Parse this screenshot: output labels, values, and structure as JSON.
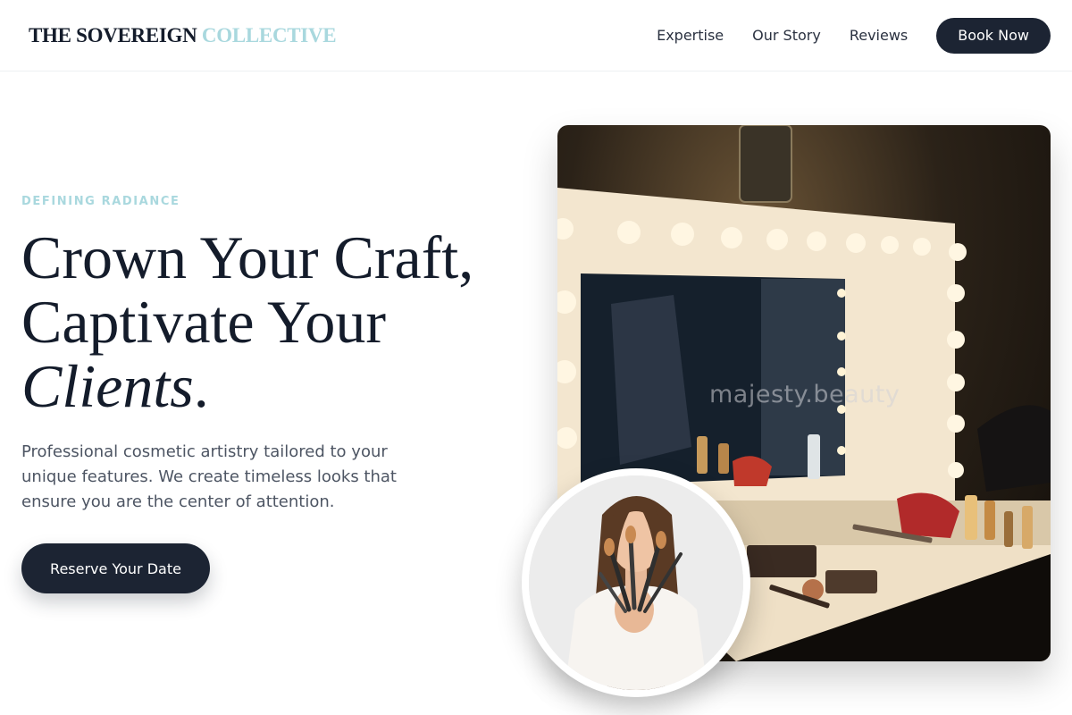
{
  "header": {
    "logo_main": "THE SOVEREIGN",
    "logo_accent": "COLLECTIVE",
    "nav": [
      {
        "label": "Expertise"
      },
      {
        "label": "Our Story"
      },
      {
        "label": "Reviews"
      }
    ],
    "cta_label": "Book Now"
  },
  "hero": {
    "eyebrow": "DEFINING RADIANCE",
    "headline_line1": "Crown Your Craft,",
    "headline_line2": "Captivate Your",
    "headline_italic": "Clients",
    "headline_period": ".",
    "subtext": "Professional cosmetic artistry tailored to your unique features. We create timeless looks that ensure you are the center of attention.",
    "cta_label": "Reserve Your Date"
  },
  "media": {
    "watermark": "majesty.beauty"
  },
  "colors": {
    "accent": "#a9d8de",
    "navy": "#1c2433"
  }
}
